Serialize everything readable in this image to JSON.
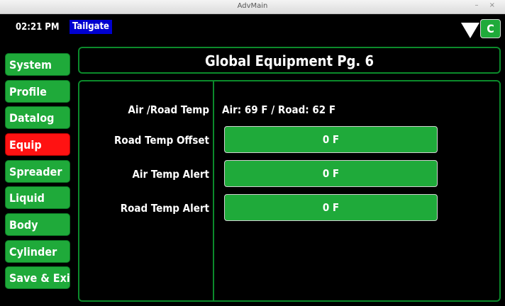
{
  "window": {
    "title": "AdvMain",
    "controls": "– ×"
  },
  "topbar": {
    "time": "02:21 PM",
    "mode": "Tailgate",
    "c_button": "C"
  },
  "sidebar": {
    "items": [
      {
        "label": "System"
      },
      {
        "label": "Profile"
      },
      {
        "label": "Datalog"
      },
      {
        "label": "Equip"
      },
      {
        "label": "Spreader"
      },
      {
        "label": "Liquid"
      },
      {
        "label": "Body"
      },
      {
        "label": "Cylinder"
      },
      {
        "label": "Save & Exit"
      }
    ],
    "active": "Equip"
  },
  "page": {
    "title": "Global Equipment Pg. 6"
  },
  "rows": [
    {
      "label": "Air /Road Temp",
      "value": "Air: 69 F / Road: 62 F"
    },
    {
      "label": "Road Temp Offset",
      "value": "0 F"
    },
    {
      "label": "Air Temp Alert",
      "value": "0 F"
    },
    {
      "label": "Road Temp Alert",
      "value": "0 F"
    }
  ],
  "colors": {
    "green": "#1faa3a",
    "active_red": "#ff1212",
    "border_green": "#0b8a2b",
    "mode_blue": "#0000d0"
  }
}
